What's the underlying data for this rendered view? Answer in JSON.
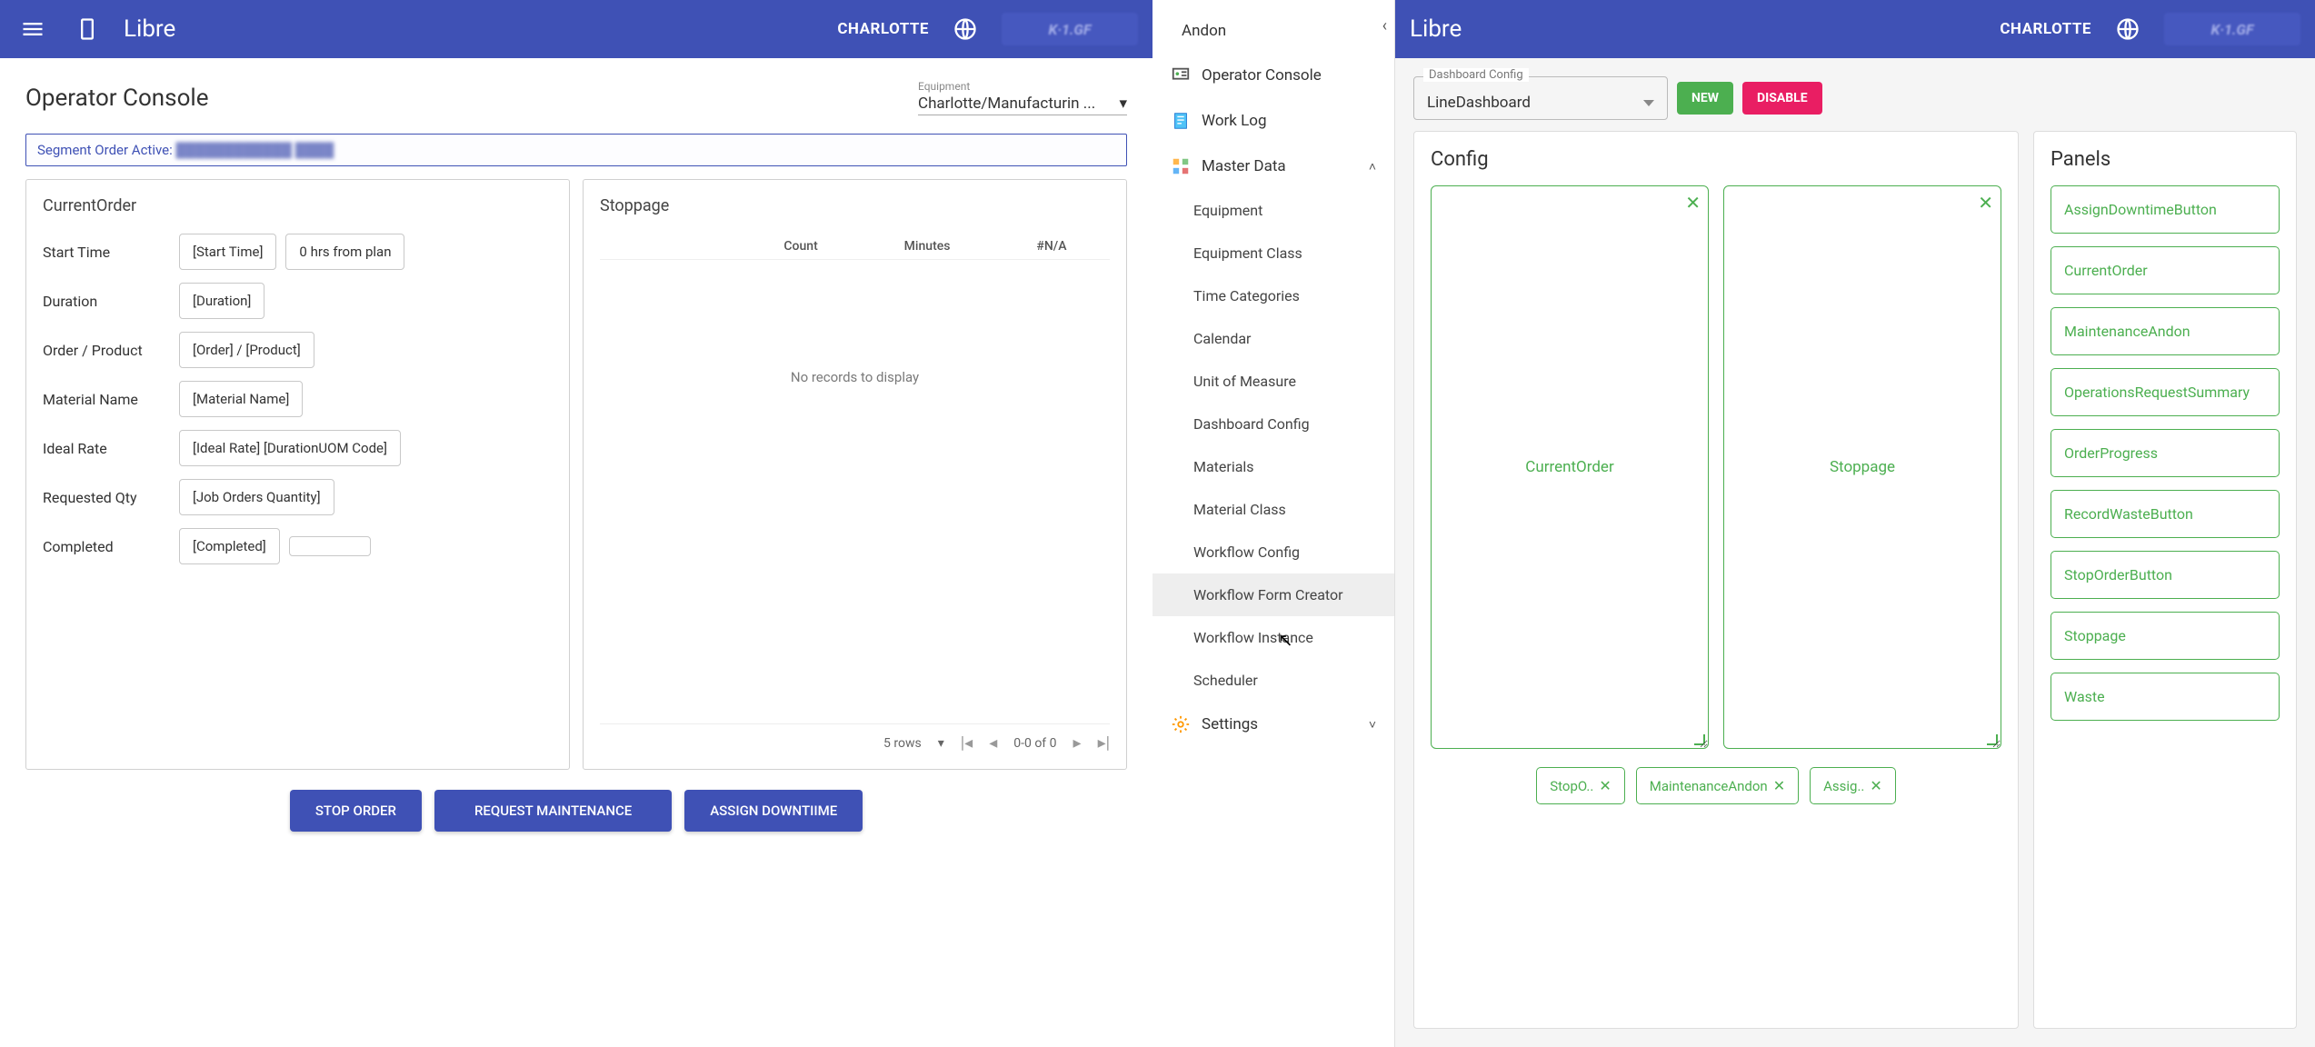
{
  "left": {
    "app_title": "Libre",
    "location": "CHARLOTTE",
    "page_title": "Operator Console",
    "equipment": {
      "label": "Equipment",
      "value": "Charlotte/Manufacturin ..."
    },
    "segment_banner": {
      "prefix": "Segment Order Active:",
      "blur": "████████████ ████"
    },
    "current_order": {
      "title": "CurrentOrder",
      "rows": {
        "start_time": {
          "label": "Start Time",
          "v1": "[Start Time]",
          "v2": "0 hrs from plan"
        },
        "duration": {
          "label": "Duration",
          "v1": "[Duration]"
        },
        "order_prod": {
          "label": "Order / Product",
          "v1": "[Order] / [Product]"
        },
        "mat_name": {
          "label": "Material Name",
          "v1": "[Material Name]"
        },
        "ideal_rate": {
          "label": "Ideal Rate",
          "v1": "[Ideal Rate] [DurationUOM Code]"
        },
        "req_qty": {
          "label": "Requested Qty",
          "v1": "[Job Orders Quantity]"
        },
        "completed": {
          "label": "Completed",
          "v1": "[Completed]",
          "v2": ""
        }
      }
    },
    "stoppage": {
      "title": "Stoppage",
      "cols": {
        "c1": "Count",
        "c2": "Minutes",
        "c3": "#N/A"
      },
      "empty": "No records to display",
      "pager": {
        "rows": "5 rows",
        "range": "0-0 of 0"
      }
    },
    "buttons": {
      "stop": "STOP ORDER",
      "maint": "REQUEST MAINTENANCE",
      "downtime": "ASSIGN DOWNTIIME"
    }
  },
  "sidebar": {
    "items": [
      {
        "label": "Andon"
      },
      {
        "label": "Operator Console"
      },
      {
        "label": "Work Log"
      },
      {
        "label": "Master Data",
        "expanded": true
      },
      {
        "label": "Settings",
        "expanded": false
      }
    ],
    "master_sub": [
      "Equipment",
      "Equipment Class",
      "Time Categories",
      "Calendar",
      "Unit of Measure",
      "Dashboard Config",
      "Materials",
      "Material Class",
      "Workflow Config",
      "Workflow Form Creator",
      "Workflow Instance",
      "Scheduler"
    ]
  },
  "right": {
    "app_title": "Libre",
    "location": "CHARLOTTE",
    "dash_select": {
      "label": "Dashboard Config",
      "value": "LineDashboard"
    },
    "btn_new": "NEW",
    "btn_dis": "DISABLE",
    "config": {
      "title": "Config",
      "slots": [
        "CurrentOrder",
        "Stoppage"
      ],
      "chips": [
        "StopO..",
        "MaintenanceAndon",
        "Assig.."
      ]
    },
    "panels": {
      "title": "Panels",
      "items": [
        "AssignDowntimeButton",
        "CurrentOrder",
        "MaintenanceAndon",
        "OperationsRequestSummary",
        "OrderProgress",
        "RecordWasteButton",
        "StopOrderButton",
        "Stoppage",
        "Waste"
      ]
    }
  }
}
